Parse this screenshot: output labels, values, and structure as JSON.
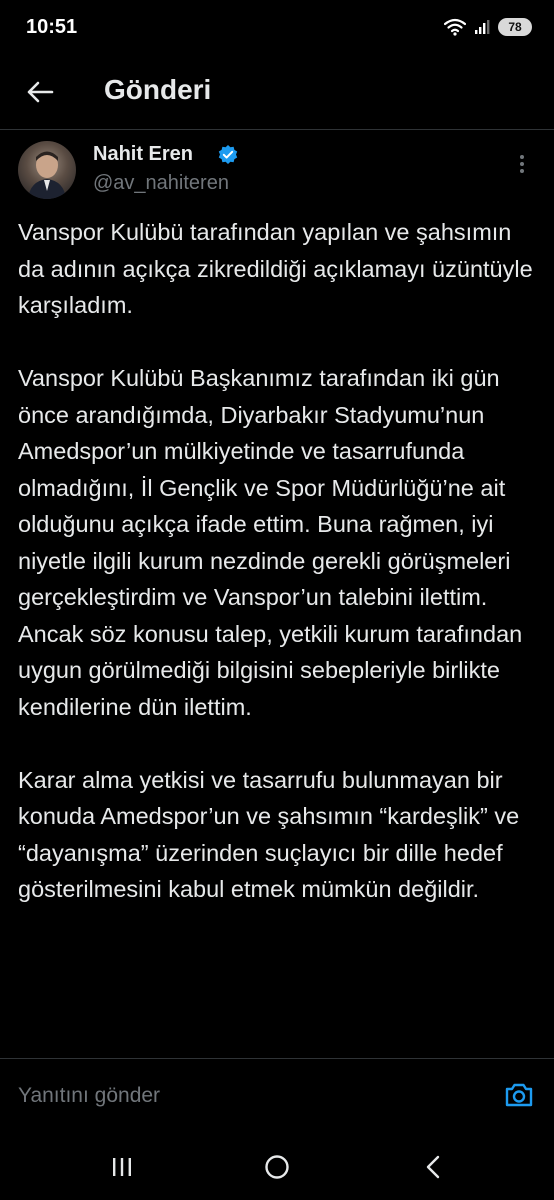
{
  "status_bar": {
    "time": "10:51",
    "battery": "78",
    "icons": [
      "wifi-icon",
      "signal-icon",
      "battery-icon"
    ]
  },
  "header": {
    "title": "Gönderi",
    "back_icon": "arrow-left-icon"
  },
  "post": {
    "author": {
      "name": "Nahit Eren",
      "handle": "@av_nahiteren",
      "verified": true
    },
    "paragraphs": [
      "Vanspor Kulübü tarafından yapılan ve şahsımın da adının açıkça zikredildiği açıklamayı üzüntüyle karşıladım.",
      "Vanspor Kulübü Başkanımız tarafından iki gün önce arandığımda, Diyarbakır Stadyumu’nun Amedspor’un mülkiyetinde ve tasarrufunda olmadığını, İl Gençlik ve Spor Müdürlüğü’ne ait olduğunu açıkça ifade ettim. Buna rağmen, iyi niyetle ilgili kurum nezdinde gerekli görüşmeleri gerçekleştirdim ve Vanspor’un talebini ilettim. Ancak söz konusu talep, yetkili kurum tarafından uygun görülmediği bilgisini sebepleriyle birlikte kendilerine dün ilettim.",
      "Karar alma yetkisi ve tasarrufu bulunmayan bir konuda Amedspor’un ve şahsımın “kardeşlik” ve “dayanışma” üzerinden suçlayıcı bir dille hedef gösterilmesini kabul etmek mümkün değildir."
    ]
  },
  "reply_bar": {
    "placeholder": "Yanıtını gönder",
    "camera_icon": "camera-icon"
  },
  "nav_bar": {
    "icons": [
      "recent-apps-icon",
      "home-icon",
      "back-icon"
    ]
  },
  "colors": {
    "background": "#000000",
    "text": "#e7e9ea",
    "secondary": "#71767b",
    "accent": "#1d9bf0",
    "divider": "#2f3336"
  }
}
